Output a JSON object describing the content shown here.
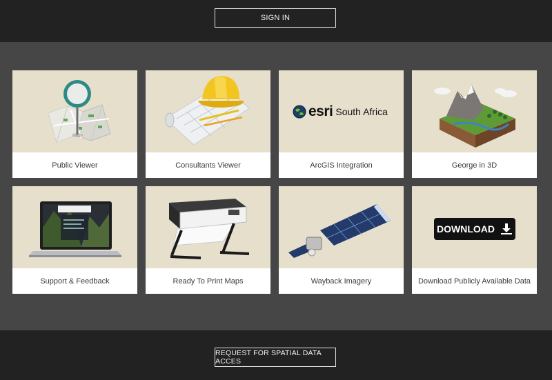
{
  "header": {
    "sign_in_label": "SIGN IN"
  },
  "cards": [
    {
      "label": "Public Viewer",
      "icon": "folded-map-pin-icon"
    },
    {
      "label": "Consultants Viewer",
      "icon": "hardhat-blueprint-icon"
    },
    {
      "label": "ArcGIS Integration",
      "icon": "esri-logo-icon",
      "logo_word": "esri",
      "logo_sub": "South Africa"
    },
    {
      "label": "George in 3D",
      "icon": "terrain-3d-icon"
    },
    {
      "label": "Support & Feedback",
      "icon": "laptop-icon",
      "screen_logo": "esri South Africa"
    },
    {
      "label": "Ready To Print Maps",
      "icon": "plotter-printer-icon"
    },
    {
      "label": "Wayback Imagery",
      "icon": "satellite-icon"
    },
    {
      "label": "Download Publicly Available Data",
      "icon": "download-button-icon",
      "button_text": "DOWNLOAD"
    }
  ],
  "footer": {
    "request_label": "REQUEST FOR SPATIAL DATA ACCES"
  },
  "colors": {
    "header_bg": "#232222",
    "content_bg": "#464646",
    "card_image_bg": "#e6dfcc",
    "card_label_bg": "#ffffff",
    "pin_teal": "#2e8a86"
  }
}
